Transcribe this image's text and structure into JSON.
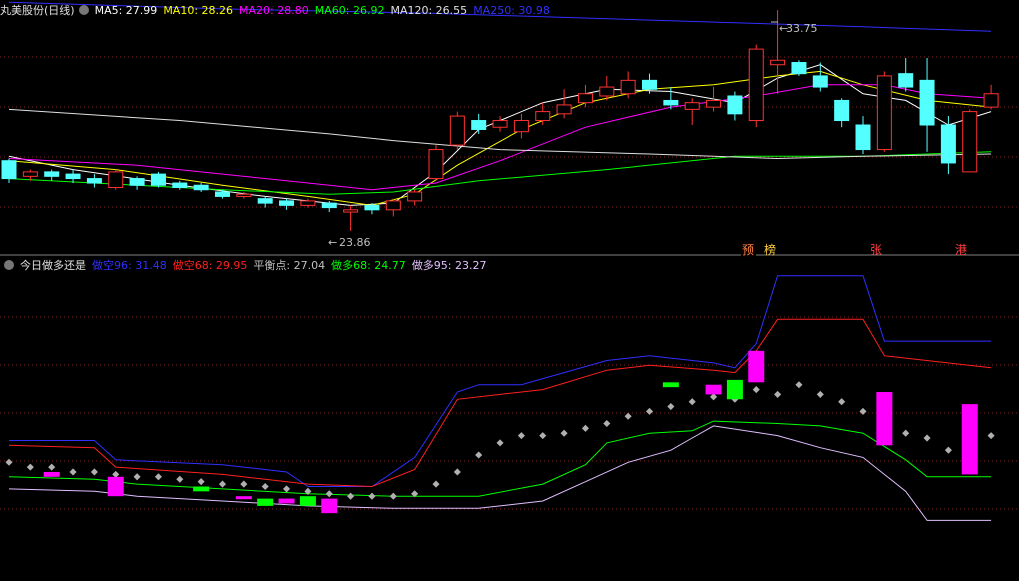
{
  "top": {
    "title": "丸美股份(日线)",
    "ma": [
      {
        "label": "MA5: 27.99",
        "color": "#ffffff"
      },
      {
        "label": "MA10: 28.26",
        "color": "#ffff00"
      },
      {
        "label": "MA20: 28.80",
        "color": "#ff00ff"
      },
      {
        "label": "MA60: 26.92",
        "color": "#00ff00"
      },
      {
        "label": "MA120: 26.55",
        "color": "#e0e0e0"
      },
      {
        "label": "MA250: 30.98",
        "color": "#3030ff"
      }
    ],
    "high_label": "33.75",
    "low_label": "23.86",
    "tags": [
      "预",
      "榜",
      "张",
      "港"
    ]
  },
  "bottom": {
    "title": "今日做多还是",
    "lines": [
      {
        "label": "做空96: 31.48",
        "color": "#3030ff"
      },
      {
        "label": "做空68: 29.95",
        "color": "#ff2020"
      },
      {
        "label": "平衡点: 27.04",
        "color": "#c0c0c0"
      },
      {
        "label": "做多68: 24.77",
        "color": "#00ff00"
      },
      {
        "label": "做多95: 23.27",
        "color": "#e0c0ff"
      }
    ]
  },
  "chart_data": {
    "type": "candlestick",
    "price_range": [
      23.0,
      34.2
    ],
    "candles": [
      [
        27.0,
        26.2,
        27.1,
        26.0,
        "d"
      ],
      [
        26.3,
        26.5,
        26.6,
        26.1,
        "u"
      ],
      [
        26.5,
        26.3,
        26.6,
        26.1,
        "d"
      ],
      [
        26.4,
        26.2,
        26.6,
        26.0,
        "d"
      ],
      [
        26.2,
        26.0,
        26.4,
        25.8,
        "d"
      ],
      [
        25.8,
        26.5,
        26.6,
        25.7,
        "u"
      ],
      [
        26.2,
        25.9,
        26.3,
        25.7,
        "d"
      ],
      [
        26.4,
        25.9,
        26.5,
        25.8,
        "d"
      ],
      [
        26.0,
        25.8,
        26.1,
        25.7,
        "d"
      ],
      [
        25.9,
        25.7,
        26.0,
        25.6,
        "d"
      ],
      [
        25.6,
        25.4,
        25.7,
        25.3,
        "d"
      ],
      [
        25.4,
        25.5,
        25.6,
        25.3,
        "u"
      ],
      [
        25.3,
        25.1,
        25.4,
        24.9,
        "d"
      ],
      [
        25.2,
        25.0,
        25.3,
        24.8,
        "d"
      ],
      [
        25.0,
        25.2,
        25.3,
        24.9,
        "u"
      ],
      [
        25.1,
        24.9,
        25.2,
        24.7,
        "d"
      ],
      [
        24.7,
        24.8,
        25.0,
        23.86,
        "u"
      ],
      [
        25.0,
        24.8,
        25.1,
        24.6,
        "d"
      ],
      [
        24.8,
        25.2,
        25.3,
        24.5,
        "u"
      ],
      [
        25.2,
        25.6,
        25.7,
        25.0,
        "u"
      ],
      [
        26.2,
        27.5,
        27.7,
        26.1,
        "u"
      ],
      [
        27.7,
        29.0,
        29.2,
        27.5,
        "u"
      ],
      [
        28.8,
        28.4,
        29.1,
        28.2,
        "d"
      ],
      [
        28.5,
        28.8,
        29.0,
        28.3,
        "u"
      ],
      [
        28.3,
        28.8,
        29.1,
        28.0,
        "u"
      ],
      [
        28.8,
        29.2,
        29.6,
        28.6,
        "u"
      ],
      [
        29.1,
        29.5,
        30.2,
        28.9,
        "u"
      ],
      [
        29.6,
        30.0,
        30.4,
        29.4,
        "u"
      ],
      [
        29.9,
        30.3,
        30.8,
        29.7,
        "u"
      ],
      [
        30.6,
        30.0,
        31.0,
        29.8,
        "u"
      ],
      [
        30.6,
        30.2,
        30.9,
        30.0,
        "d"
      ],
      [
        29.7,
        29.5,
        30.3,
        29.3,
        "d"
      ],
      [
        29.6,
        29.3,
        29.8,
        28.6,
        "u"
      ],
      [
        29.4,
        29.7,
        30.3,
        29.2,
        "u"
      ],
      [
        29.9,
        29.1,
        30.1,
        28.8,
        "d"
      ],
      [
        28.8,
        32.0,
        32.2,
        28.5,
        "u"
      ],
      [
        31.3,
        31.5,
        33.75,
        30.0,
        "u"
      ],
      [
        31.4,
        30.9,
        31.5,
        30.8,
        "d"
      ],
      [
        30.8,
        30.3,
        31.4,
        30.1,
        "d"
      ],
      [
        29.7,
        28.8,
        29.8,
        28.5,
        "d"
      ],
      [
        28.6,
        27.5,
        29.0,
        27.3,
        "d"
      ],
      [
        27.5,
        30.8,
        31.0,
        27.4,
        "u"
      ],
      [
        30.9,
        30.3,
        31.6,
        30.1,
        "d"
      ],
      [
        30.6,
        28.6,
        31.6,
        27.4,
        "d"
      ],
      [
        28.6,
        26.9,
        29.0,
        26.4,
        "d"
      ],
      [
        26.5,
        29.2,
        29.3,
        26.5,
        "u"
      ],
      [
        29.4,
        30.0,
        30.4,
        29.3,
        "u"
      ]
    ],
    "ma_lines": {
      "MA5": [
        [
          0,
          27.2
        ],
        [
          3,
          26.6
        ],
        [
          8,
          25.9
        ],
        [
          12,
          25.4
        ],
        [
          16,
          25.0
        ],
        [
          18,
          25.1
        ],
        [
          20,
          26.5
        ],
        [
          22,
          28.4
        ],
        [
          25,
          29.6
        ],
        [
          28,
          30.2
        ],
        [
          31,
          30.1
        ],
        [
          34,
          29.6
        ],
        [
          36,
          30.7
        ],
        [
          38,
          31.3
        ],
        [
          40,
          30.0
        ],
        [
          42,
          29.7
        ],
        [
          44,
          28.6
        ],
        [
          46,
          29.2
        ]
      ],
      "MA10": [
        [
          0,
          27.0
        ],
        [
          5,
          26.6
        ],
        [
          10,
          25.9
        ],
        [
          14,
          25.4
        ],
        [
          17,
          25.0
        ],
        [
          19,
          25.5
        ],
        [
          21,
          26.8
        ],
        [
          24,
          28.4
        ],
        [
          27,
          29.6
        ],
        [
          30,
          30.2
        ],
        [
          33,
          30.4
        ],
        [
          36,
          30.8
        ],
        [
          38,
          31.0
        ],
        [
          40,
          30.4
        ],
        [
          43,
          29.7
        ],
        [
          46,
          29.4
        ]
      ],
      "MA20": [
        [
          0,
          27.1
        ],
        [
          6,
          26.8
        ],
        [
          10,
          26.4
        ],
        [
          14,
          26.0
        ],
        [
          17,
          25.7
        ],
        [
          20,
          26.0
        ],
        [
          23,
          27.0
        ],
        [
          27,
          28.5
        ],
        [
          31,
          29.4
        ],
        [
          35,
          29.9
        ],
        [
          38,
          30.4
        ],
        [
          41,
          30.4
        ],
        [
          43,
          30.0
        ],
        [
          46,
          29.8
        ]
      ],
      "MA60": [
        [
          0,
          26.2
        ],
        [
          10,
          25.7
        ],
        [
          15,
          25.5
        ],
        [
          18,
          25.6
        ],
        [
          22,
          26.1
        ],
        [
          28,
          26.6
        ],
        [
          34,
          27.2
        ],
        [
          40,
          27.2
        ],
        [
          46,
          27.4
        ]
      ],
      "MA120": [
        [
          0,
          29.3
        ],
        [
          8,
          28.8
        ],
        [
          15,
          28.2
        ],
        [
          18,
          27.9
        ],
        [
          23,
          27.5
        ],
        [
          30,
          27.3
        ],
        [
          36,
          27.1
        ],
        [
          40,
          27.2
        ],
        [
          46,
          27.3
        ]
      ],
      "MA250": [
        [
          0,
          34.1
        ],
        [
          10,
          33.8
        ],
        [
          20,
          33.6
        ],
        [
          30,
          33.3
        ],
        [
          40,
          33.0
        ],
        [
          46,
          32.8
        ]
      ]
    },
    "indicator": {
      "range": [
        21.5,
        34.5
      ],
      "short96": [
        [
          0,
          27.3
        ],
        [
          4,
          27.3
        ],
        [
          5,
          26.5
        ],
        [
          10,
          26.3
        ],
        [
          13,
          26.0
        ],
        [
          14,
          25.4
        ],
        [
          17,
          25.4
        ],
        [
          19,
          26.6
        ],
        [
          21,
          29.3
        ],
        [
          22,
          29.6
        ],
        [
          24,
          29.6
        ],
        [
          26,
          30.1
        ],
        [
          28,
          30.6
        ],
        [
          30,
          30.8
        ],
        [
          33,
          30.5
        ],
        [
          34,
          30.3
        ],
        [
          35,
          31.3
        ],
        [
          36,
          34.1
        ],
        [
          40,
          34.1
        ],
        [
          41,
          31.4
        ],
        [
          46,
          31.4
        ]
      ],
      "short68": [
        [
          0,
          27.1
        ],
        [
          4,
          27.0
        ],
        [
          5,
          26.2
        ],
        [
          10,
          25.9
        ],
        [
          14,
          25.5
        ],
        [
          17,
          25.4
        ],
        [
          19,
          26.1
        ],
        [
          21,
          29.0
        ],
        [
          23,
          29.2
        ],
        [
          25,
          29.4
        ],
        [
          28,
          30.2
        ],
        [
          30,
          30.4
        ],
        [
          33,
          30.2
        ],
        [
          34,
          30.1
        ],
        [
          35,
          31.0
        ],
        [
          36,
          32.3
        ],
        [
          40,
          32.3
        ],
        [
          41,
          30.8
        ],
        [
          46,
          30.3
        ]
      ],
      "balance": [
        [
          0,
          26.4
        ],
        [
          1,
          26.2
        ],
        [
          2,
          26.2
        ],
        [
          3,
          26.0
        ],
        [
          4,
          26.0
        ],
        [
          5,
          25.9
        ],
        [
          6,
          25.8
        ],
        [
          7,
          25.8
        ],
        [
          8,
          25.7
        ],
        [
          9,
          25.6
        ],
        [
          10,
          25.5
        ],
        [
          11,
          25.5
        ],
        [
          12,
          25.4
        ],
        [
          13,
          25.3
        ],
        [
          14,
          25.2
        ],
        [
          15,
          25.1
        ],
        [
          16,
          25.0
        ],
        [
          17,
          25.0
        ],
        [
          18,
          25.0
        ],
        [
          19,
          25.1
        ],
        [
          20,
          25.5
        ],
        [
          21,
          26.0
        ],
        [
          22,
          26.7
        ],
        [
          23,
          27.2
        ],
        [
          24,
          27.5
        ],
        [
          25,
          27.5
        ],
        [
          26,
          27.6
        ],
        [
          27,
          27.8
        ],
        [
          28,
          28.0
        ],
        [
          29,
          28.3
        ],
        [
          30,
          28.5
        ],
        [
          31,
          28.7
        ],
        [
          32,
          28.9
        ],
        [
          33,
          29.1
        ],
        [
          34,
          29.0
        ],
        [
          35,
          29.4
        ],
        [
          36,
          29.2
        ],
        [
          37,
          29.6
        ],
        [
          38,
          29.2
        ],
        [
          39,
          28.9
        ],
        [
          40,
          28.5
        ],
        [
          41,
          28.0
        ],
        [
          42,
          27.6
        ],
        [
          43,
          27.4
        ],
        [
          44,
          26.9
        ],
        [
          45,
          27.3
        ],
        [
          46,
          27.5
        ]
      ],
      "long68": [
        [
          0,
          25.8
        ],
        [
          4,
          25.7
        ],
        [
          6,
          25.5
        ],
        [
          10,
          25.3
        ],
        [
          14,
          25.1
        ],
        [
          18,
          25.0
        ],
        [
          22,
          25.0
        ],
        [
          25,
          25.5
        ],
        [
          27,
          26.3
        ],
        [
          28,
          27.2
        ],
        [
          30,
          27.6
        ],
        [
          32,
          27.7
        ],
        [
          33,
          28.1
        ],
        [
          36,
          28.0
        ],
        [
          38,
          27.9
        ],
        [
          40,
          27.6
        ],
        [
          42,
          26.5
        ],
        [
          43,
          25.8
        ],
        [
          46,
          25.8
        ]
      ],
      "long95": [
        [
          0,
          25.3
        ],
        [
          4,
          25.2
        ],
        [
          6,
          25.0
        ],
        [
          10,
          24.8
        ],
        [
          14,
          24.6
        ],
        [
          18,
          24.5
        ],
        [
          22,
          24.5
        ],
        [
          25,
          24.8
        ],
        [
          27,
          25.6
        ],
        [
          29,
          26.4
        ],
        [
          31,
          26.9
        ],
        [
          32,
          27.4
        ],
        [
          33,
          27.9
        ],
        [
          36,
          27.5
        ],
        [
          38,
          27.0
        ],
        [
          40,
          26.6
        ],
        [
          42,
          25.2
        ],
        [
          43,
          24.0
        ],
        [
          46,
          24.0
        ]
      ],
      "bars": [
        [
          2,
          26.0,
          25.8,
          "m"
        ],
        [
          5,
          25.8,
          25.0,
          "m"
        ],
        [
          9,
          25.4,
          25.2,
          "g"
        ],
        [
          11,
          25.0,
          24.9,
          "m"
        ],
        [
          12,
          24.9,
          24.6,
          "g"
        ],
        [
          13,
          24.9,
          24.7,
          "m"
        ],
        [
          14,
          25.0,
          24.6,
          "g"
        ],
        [
          15,
          24.9,
          24.3,
          "m"
        ],
        [
          31,
          29.7,
          29.5,
          "g"
        ],
        [
          33,
          29.6,
          29.2,
          "m"
        ],
        [
          34,
          29.8,
          29.0,
          "g"
        ],
        [
          35,
          31.0,
          29.7,
          "m"
        ],
        [
          41,
          29.3,
          27.1,
          "m"
        ],
        [
          45,
          28.8,
          25.9,
          "m"
        ]
      ]
    }
  }
}
